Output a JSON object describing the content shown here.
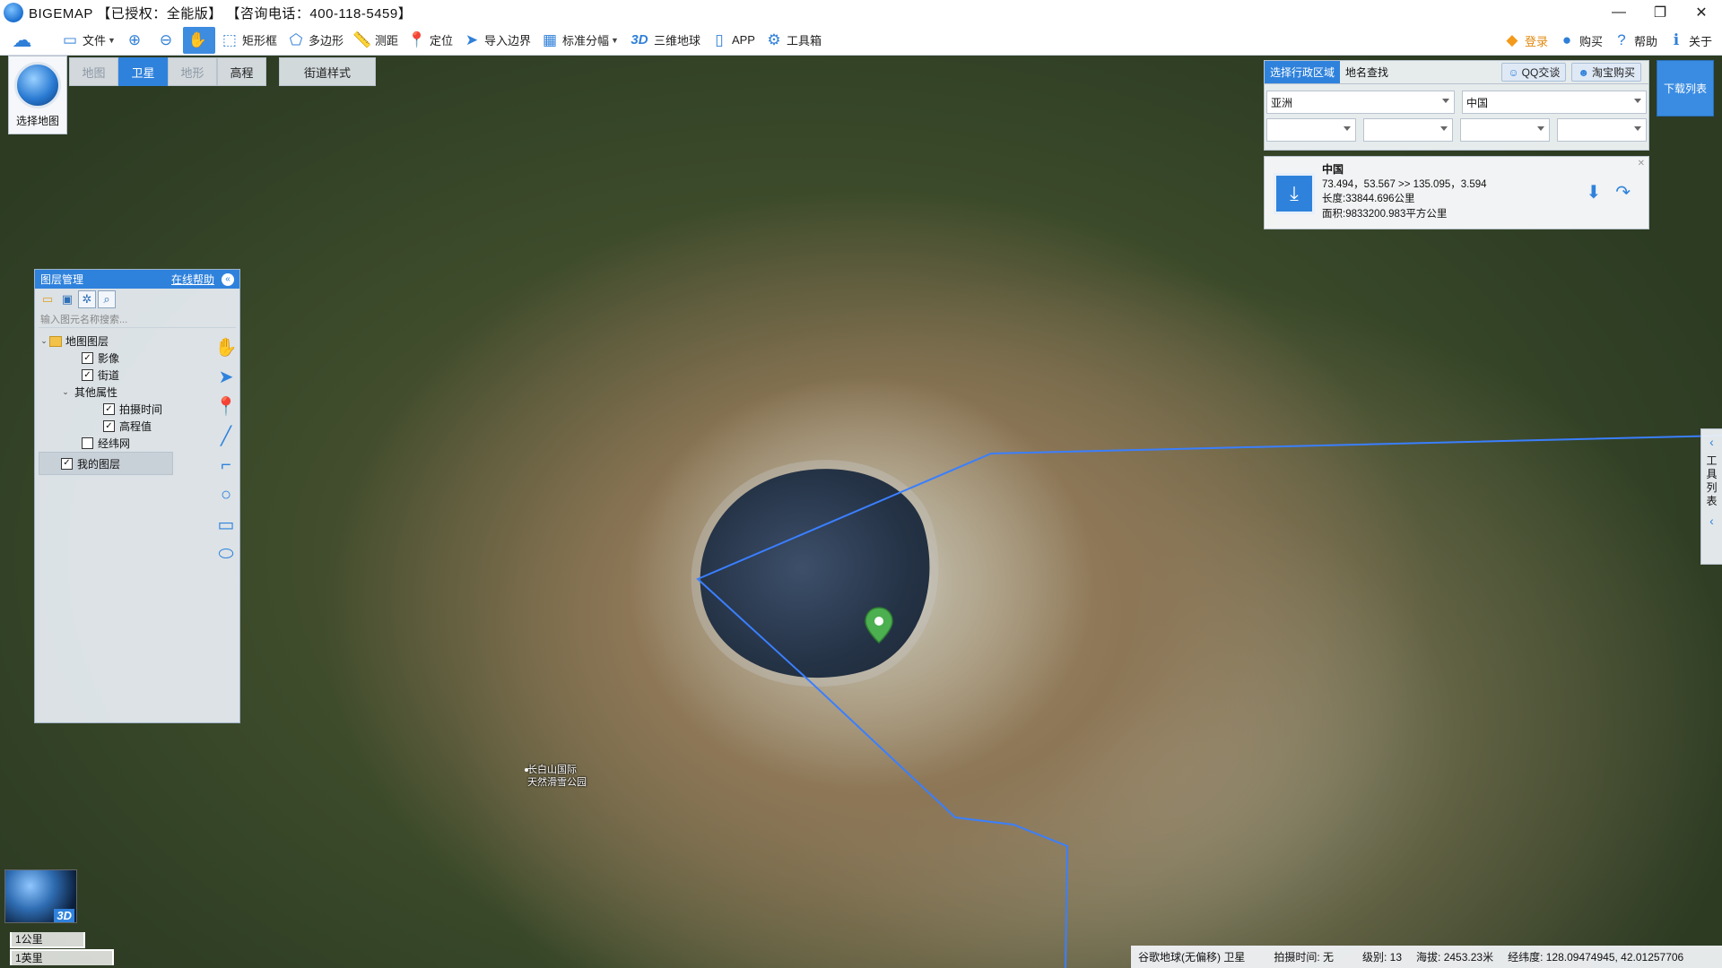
{
  "app": {
    "title": "BIGEMAP 【已授权：全能版】 【咨询电话：400-118-5459】"
  },
  "window_controls": {
    "minimize": "—",
    "maximize": "❐",
    "close": "✕"
  },
  "toolbar": {
    "file": "文件",
    "zoom_in_icon": "zoom-in-icon",
    "zoom_out_icon": "zoom-out-icon",
    "rect_frame": "矩形框",
    "polygon": "多边形",
    "measure": "测距",
    "locate": "定位",
    "import_boundary": "导入边界",
    "standard_sheet": "标准分幅",
    "three_d_label": "3D",
    "globe_3d": "三维地球",
    "app": "APP",
    "toolbox": "工具箱",
    "login": "登录",
    "buy": "购买",
    "help": "帮助",
    "about": "关于"
  },
  "map_selector": {
    "select_map": "选择地图",
    "types": [
      {
        "label": "地图",
        "active": false
      },
      {
        "label": "卫星",
        "active": true
      },
      {
        "label": "地形",
        "active": false
      },
      {
        "label": "高程",
        "active": false
      }
    ],
    "street_style": "街道样式"
  },
  "layer_panel": {
    "title": "图层管理",
    "online_help": "在线帮助",
    "search_placeholder": "输入图元名称搜索...",
    "tree": {
      "map_layers": "地图图层",
      "imagery": "影像",
      "streets": "街道",
      "other_attrs": "其他属性",
      "capture_time": "拍摄时间",
      "elevation_value": "高程值",
      "graticule": "经纬网",
      "my_layers": "我的图层"
    },
    "checked": {
      "imagery": true,
      "streets": true,
      "capture_time": true,
      "elevation_value": true,
      "graticule": false,
      "my_layers": true
    }
  },
  "admin_panel": {
    "tab_region": "选择行政区域",
    "tab_search": "地名查找",
    "qq": "QQ交谈",
    "taobao": "淘宝购买",
    "continent": "亚洲",
    "country": "中国",
    "result": {
      "name": "中国",
      "bounds": "73.494，53.567 >> 135.095，3.594",
      "length": "长度:33844.696公里",
      "area": "面积:9833200.983平方公里"
    }
  },
  "download_list": "下载列表",
  "tool_list": "工具列表",
  "map_labels": {
    "poi_name_1": "长白山国际",
    "poi_name_2": "天然滑雪公园"
  },
  "globe_thumb": {
    "label": "3D"
  },
  "scale": {
    "km": "1公里",
    "mile": "1英里"
  },
  "status": {
    "source": "谷歌地球(无偏移) 卫星",
    "capture": "拍摄时间: 无",
    "level": "级别:  13",
    "altitude": "海拔: 2453.23米",
    "coords": "经纬度:   128.09474945, 42.01257706"
  }
}
